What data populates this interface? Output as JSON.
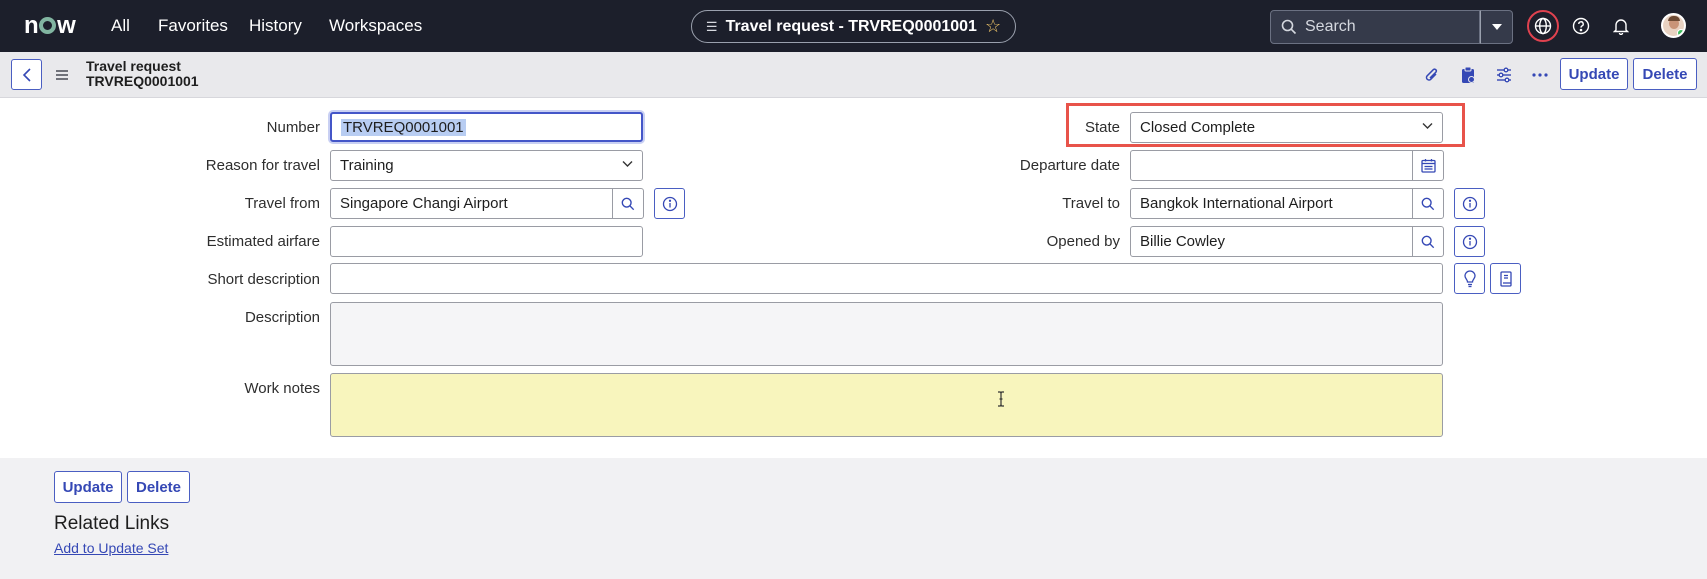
{
  "topnav": {
    "logo": "now",
    "links": [
      "All",
      "Favorites",
      "History",
      "Workspaces"
    ],
    "record_title": "Travel request - TRVREQ0001001",
    "search_placeholder": "Search"
  },
  "form_header": {
    "title_line1": "Travel request",
    "title_line2": "TRVREQ0001001",
    "update_label": "Update",
    "delete_label": "Delete"
  },
  "form": {
    "number": {
      "label": "Number",
      "value": "TRVREQ0001001"
    },
    "reason": {
      "label": "Reason for travel",
      "value": "Training"
    },
    "travel_from": {
      "label": "Travel from",
      "value": "Singapore Changi Airport"
    },
    "estimated_airfare": {
      "label": "Estimated airfare",
      "value": ""
    },
    "short_description": {
      "label": "Short description",
      "value": ""
    },
    "description": {
      "label": "Description",
      "value": ""
    },
    "work_notes": {
      "label": "Work notes",
      "value": ""
    },
    "state": {
      "label": "State",
      "value": "Closed Complete"
    },
    "departure_date": {
      "label": "Departure date",
      "value": ""
    },
    "travel_to": {
      "label": "Travel to",
      "value": "Bangkok International Airport"
    },
    "opened_by": {
      "label": "Opened by",
      "value": "Billie Cowley"
    }
  },
  "bottom": {
    "update_label": "Update",
    "delete_label": "Delete",
    "related_links_title": "Related Links",
    "add_to_update_set": "Add to Update Set"
  },
  "colors": {
    "nav_bg": "#1c1f2b",
    "accent": "#4a5ec2",
    "work_notes_bg": "#f8f5bd",
    "highlight": "#e8534a"
  }
}
